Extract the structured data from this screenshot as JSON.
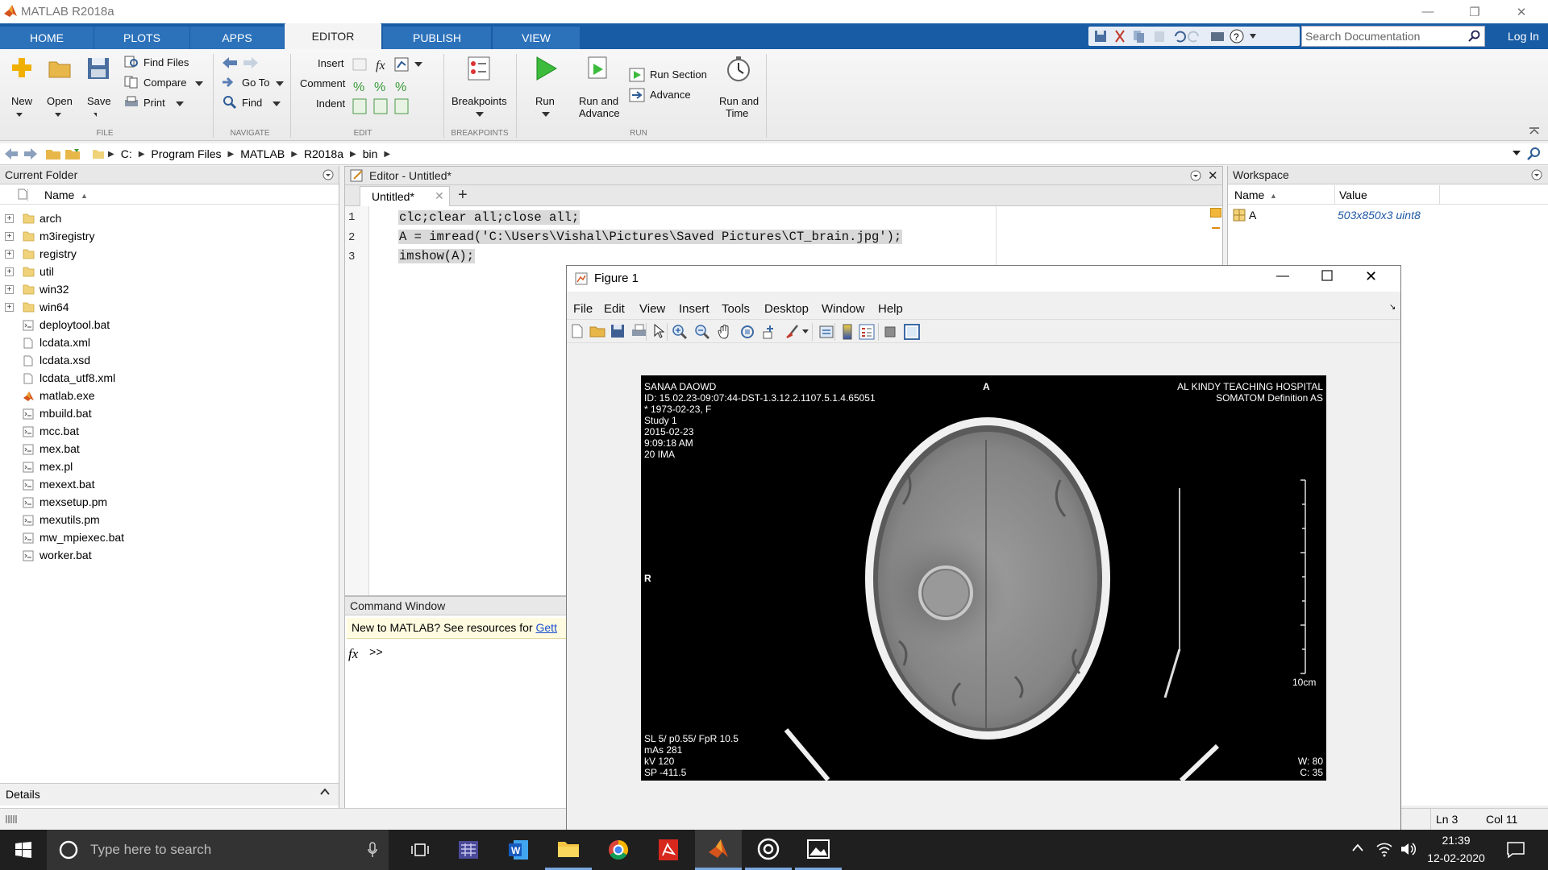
{
  "window": {
    "title": "MATLAB R2018a"
  },
  "tabs": [
    {
      "label": "HOME"
    },
    {
      "label": "PLOTS"
    },
    {
      "label": "APPS"
    },
    {
      "label": "EDITOR"
    },
    {
      "label": "PUBLISH"
    },
    {
      "label": "VIEW"
    }
  ],
  "search": {
    "placeholder": "Search Documentation"
  },
  "login": "Log In",
  "ribbon": {
    "file": {
      "new": "New",
      "open": "Open",
      "save": "Save",
      "find_files": "Find Files",
      "compare": "Compare",
      "print": "Print",
      "group": "FILE"
    },
    "navigate": {
      "go_to": "Go To",
      "find": "Find",
      "group": "NAVIGATE"
    },
    "edit": {
      "insert": "Insert",
      "comment": "Comment",
      "indent": "Indent",
      "group": "EDIT"
    },
    "breakpoints": {
      "label": "Breakpoints",
      "group": "BREAKPOINTS"
    },
    "run": {
      "run": "Run",
      "run_advance_1": "Run and",
      "run_advance_2": "Advance",
      "run_section": "Run Section",
      "advance": "Advance",
      "run_time_1": "Run and",
      "run_time_2": "Time",
      "group": "RUN"
    }
  },
  "path": [
    "C:",
    "Program Files",
    "MATLAB",
    "R2018a",
    "bin"
  ],
  "current_folder": {
    "title": "Current Folder",
    "column": "Name",
    "folders": [
      "arch",
      "m3iregistry",
      "registry",
      "util",
      "win32",
      "win64"
    ],
    "files": [
      "deploytool.bat",
      "lcdata.xml",
      "lcdata.xsd",
      "lcdata_utf8.xml",
      "matlab.exe",
      "mbuild.bat",
      "mcc.bat",
      "mex.bat",
      "mex.pl",
      "mexext.bat",
      "mexsetup.pm",
      "mexutils.pm",
      "mw_mpiexec.bat",
      "worker.bat"
    ],
    "details": "Details"
  },
  "editor": {
    "title": "Editor - Untitled*",
    "tab": "Untitled*",
    "lines": [
      {
        "num": "1",
        "code": "clc;clear all;close all;"
      },
      {
        "num": "2",
        "code": "A = imread('C:\\Users\\Vishal\\Pictures\\Saved Pictures\\CT_brain.jpg');"
      },
      {
        "num": "3",
        "code": "imshow(A);"
      }
    ]
  },
  "command_window": {
    "title": "Command Window",
    "banner": "New to MATLAB? See resources for ",
    "banner_link": "Gett",
    "prompt": ">>"
  },
  "workspace": {
    "title": "Workspace",
    "columns": [
      "Name",
      "Value"
    ],
    "rows": [
      {
        "name": "A",
        "value": "503x850x3 uint8"
      }
    ]
  },
  "figure": {
    "title": "Figure 1",
    "menu": [
      "File",
      "Edit",
      "View",
      "Insert",
      "Tools",
      "Desktop",
      "Window",
      "Help"
    ],
    "overlay": {
      "top_left": "SANAA DAOWD\nID: 15.02.23-09:07:44-DST-1.3.12.2.1107.5.1.4.65051\n* 1973-02-23, F\nStudy 1\n2015-02-23\n9:09:18 AM\n20 IMA",
      "top_center": "A",
      "top_right": "AL KINDY TEACHING HOSPITAL\nSOMATOM Definition AS",
      "left_mid": "R",
      "scale": "10cm",
      "bottom_left": "SL 5/ p0.55/ FpR 10.5\nmAs 281\nkV 120\nSP -411.5",
      "bottom_right": "W: 80\nC: 35"
    }
  },
  "status": {
    "ln": "Ln  3",
    "col": "Col  11"
  },
  "taskbar": {
    "search": "Type here to search",
    "time": "21:39",
    "date": "12-02-2020"
  }
}
